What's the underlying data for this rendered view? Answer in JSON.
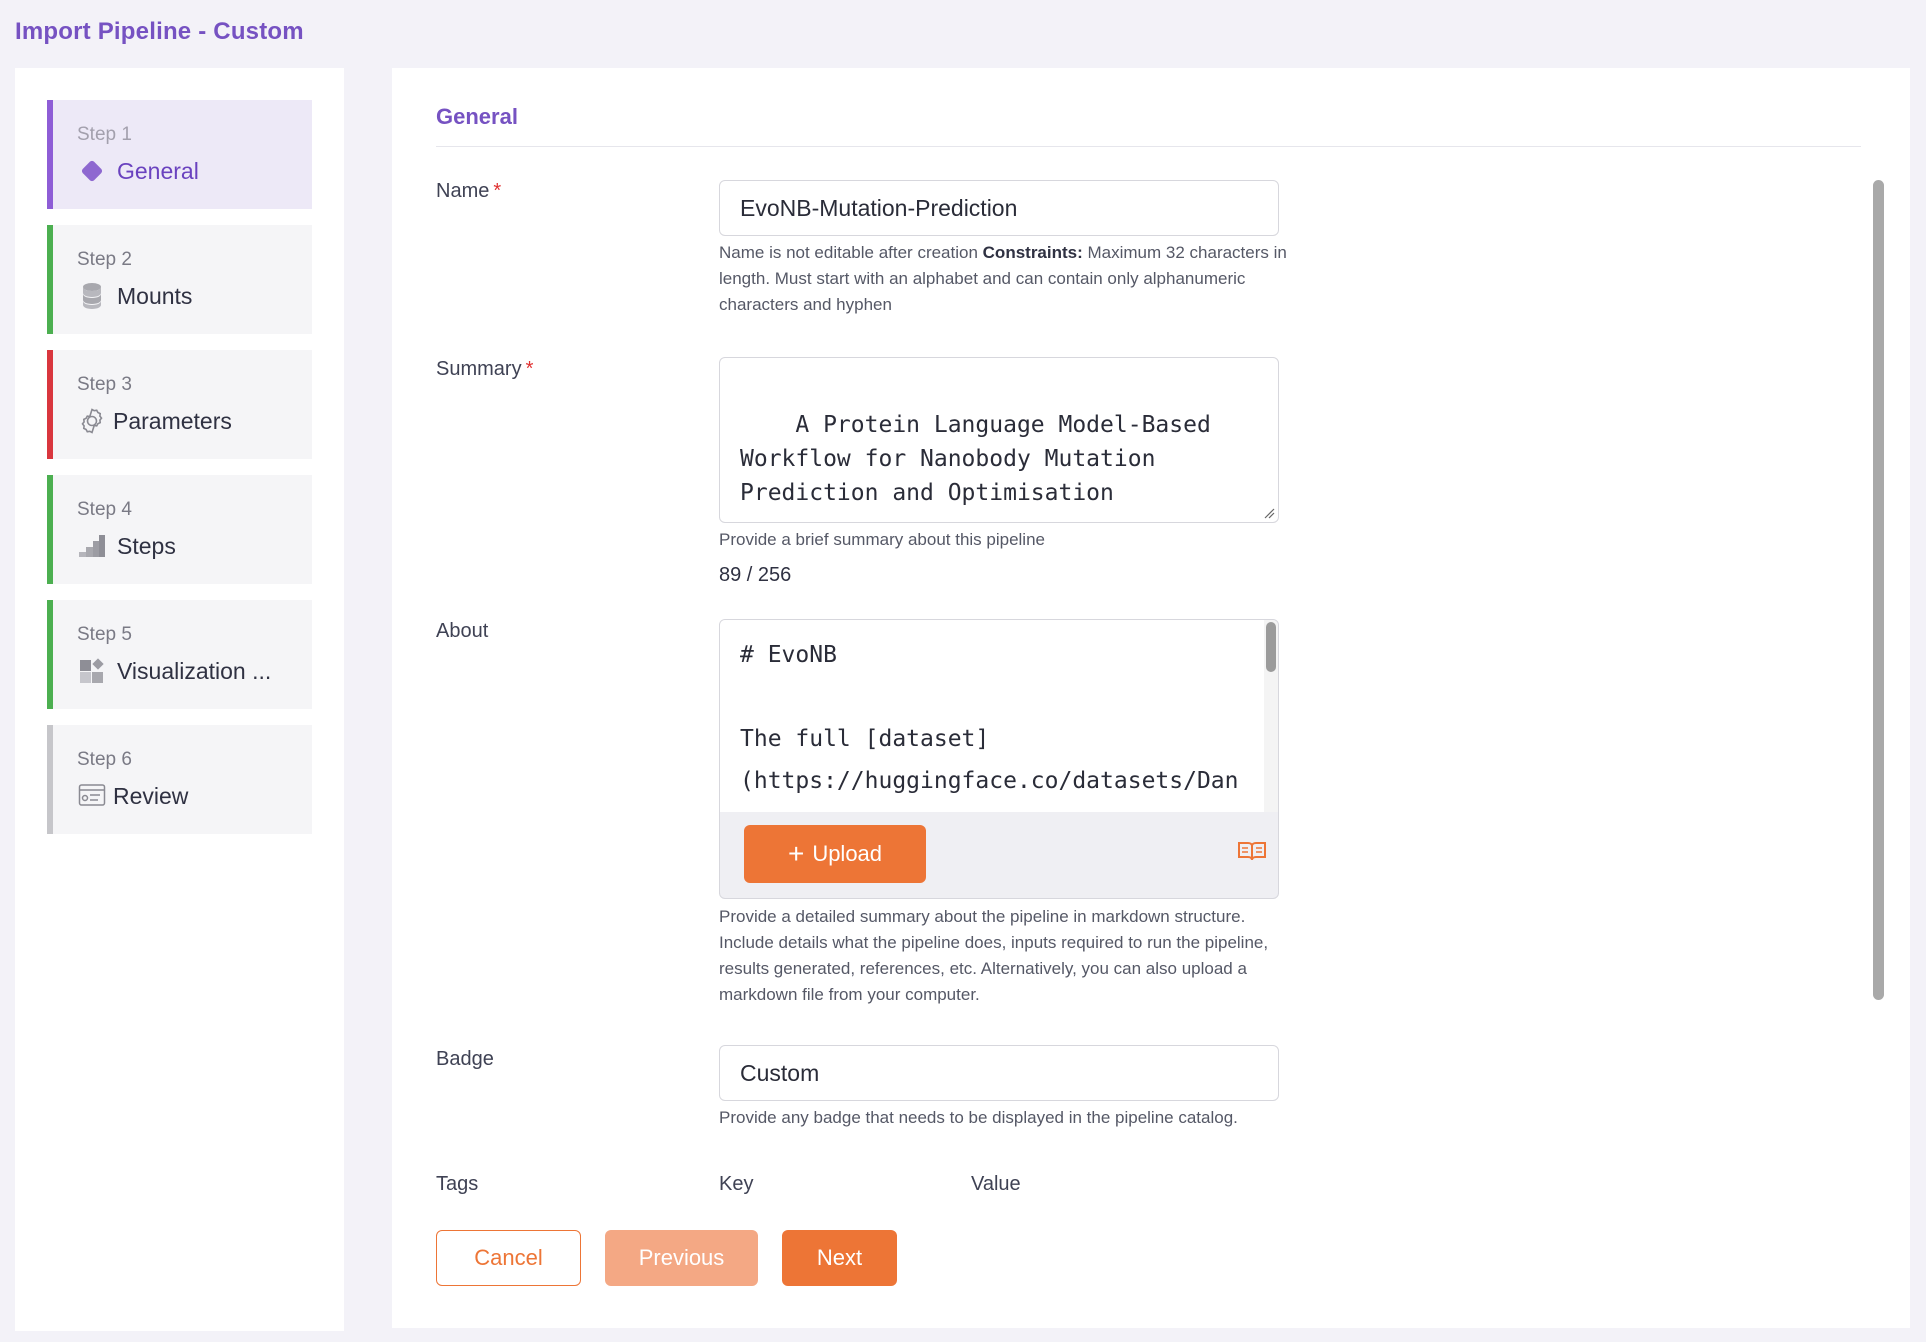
{
  "header": {
    "title": "Import Pipeline - Custom"
  },
  "stepper": {
    "steps": [
      {
        "num": "Step 1",
        "label": "General",
        "icon": "diamond-icon",
        "color": "#8e5dd6",
        "active": true
      },
      {
        "num": "Step 2",
        "label": "Mounts",
        "icon": "database-icon",
        "color": "#4caf50"
      },
      {
        "num": "Step 3",
        "label": "Parameters",
        "icon": "gear-icon",
        "color": "#d9363e"
      },
      {
        "num": "Step 4",
        "label": "Steps",
        "icon": "steps-icon",
        "color": "#4caf50"
      },
      {
        "num": "Step 5",
        "label": "Visualization ...",
        "icon": "visualization-icon",
        "color": "#4caf50"
      },
      {
        "num": "Step 6",
        "label": "Review",
        "icon": "review-icon",
        "color": "#c6c6ca"
      }
    ]
  },
  "general": {
    "title": "General",
    "name": {
      "label": "Name",
      "value": "EvoNB-Mutation-Prediction",
      "help_prefix": "Name is not editable after creation ",
      "help_bold": "Constraints:",
      "help_suffix": " Maximum 32 characters in length. Must start with an alphabet and can contain only alphanumeric characters and hyphen"
    },
    "summary": {
      "label": "Summary",
      "value": "A Protein Language Model-Based\nWorkflow for Nanobody Mutation\nPrediction and Optimisation",
      "help": "Provide a brief summary about this pipeline",
      "counter": "89 / 256"
    },
    "about": {
      "label": "About",
      "value": "# EvoNB\n\nThe full [dataset]\n(https://huggingface.co/datasets/Dan",
      "upload_label": "Upload",
      "help": "Provide a detailed summary about the pipeline in markdown structure. Include details what the pipeline does, inputs required to run the pipeline, results generated, references, etc. Alternatively, you can also upload a markdown file from your computer."
    },
    "badge": {
      "label": "Badge",
      "value": "Custom",
      "help": "Provide any badge that needs to be displayed in the pipeline catalog."
    },
    "tags": {
      "label": "Tags",
      "key_label": "Key",
      "value_label": "Value"
    }
  },
  "actions": {
    "cancel": "Cancel",
    "previous": "Previous",
    "next": "Next"
  },
  "required_marker": "*",
  "colors": {
    "accent": "#ed7536",
    "brand": "#7652c2"
  }
}
